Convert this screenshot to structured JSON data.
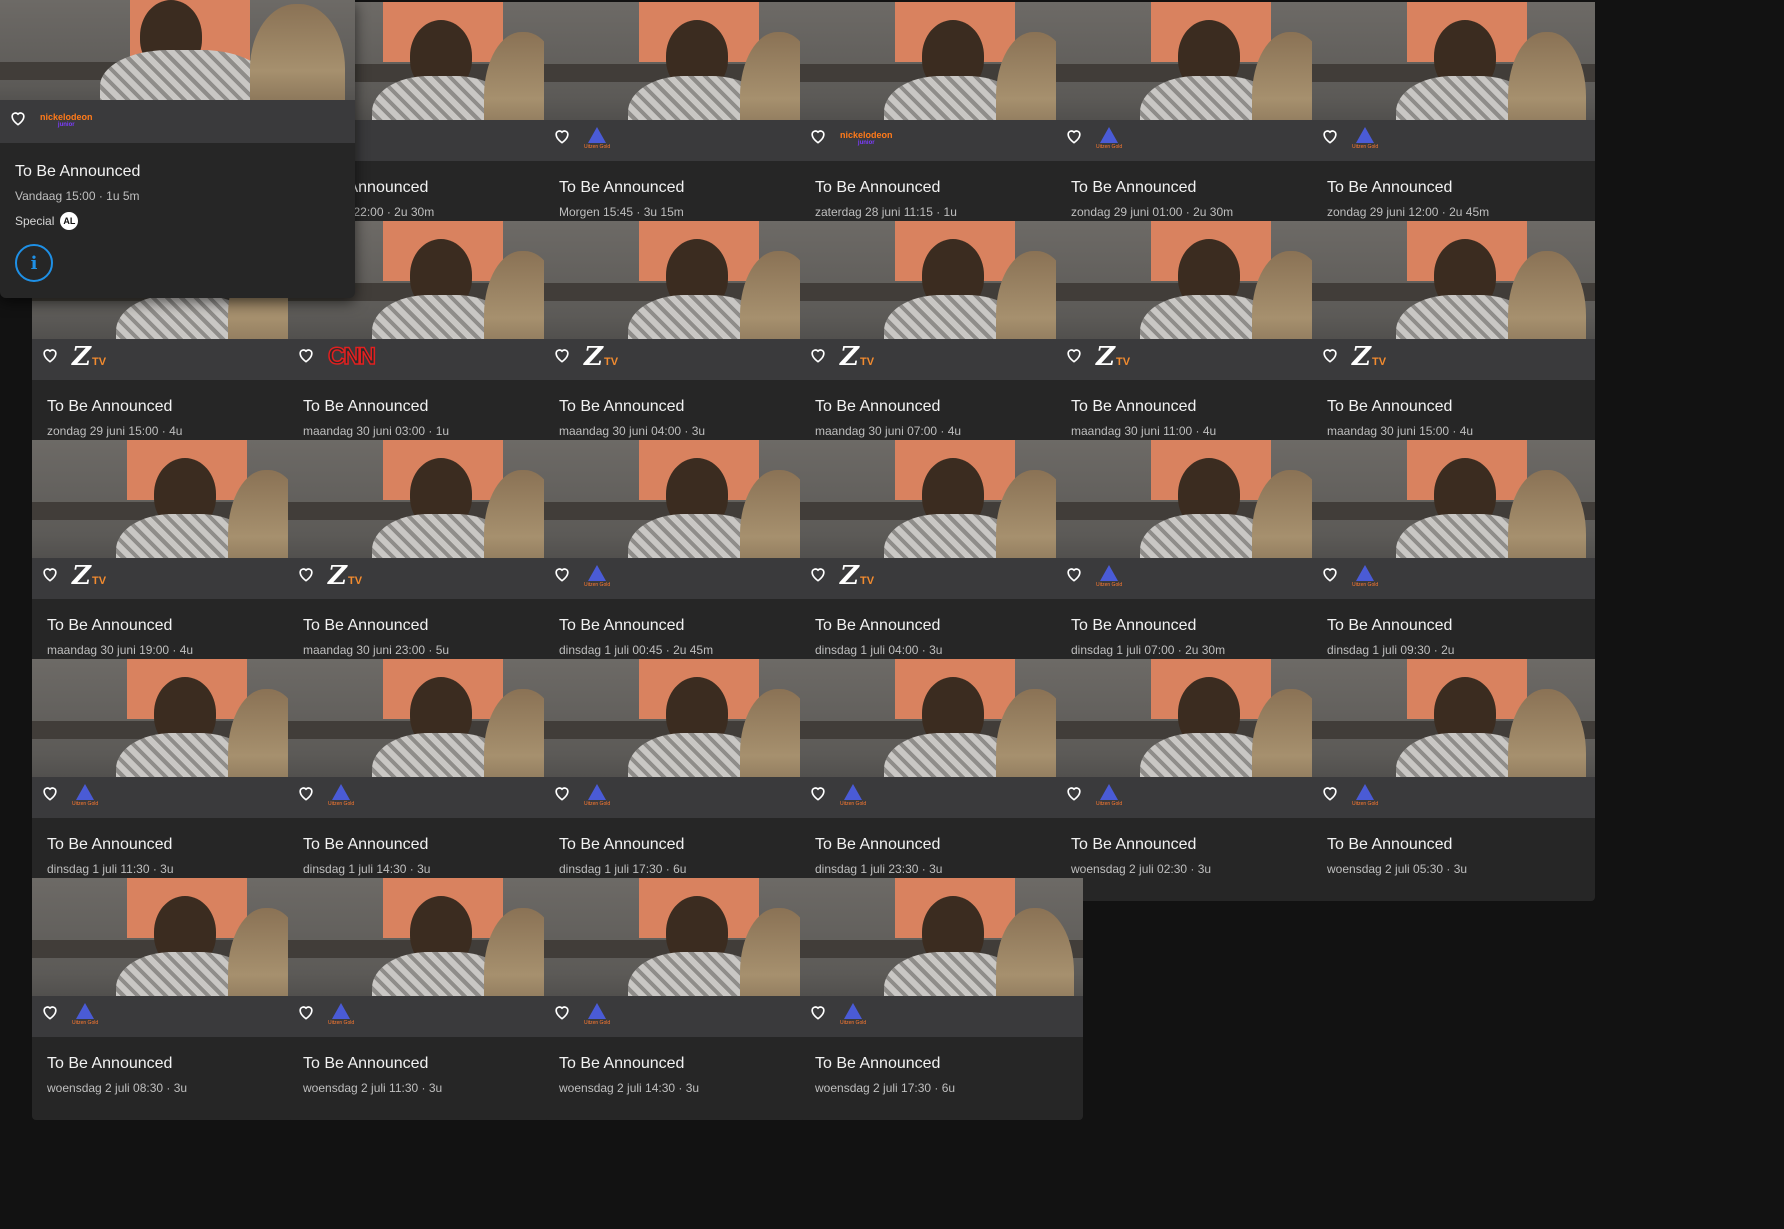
{
  "hover_card": {
    "title": "To Be Announced",
    "meta": "Vandaag 15:00 · 1u 5m",
    "genre": "Special",
    "age_rating": "AL",
    "channel_logo": "nickelodeon",
    "logo_text": "nickelodeon",
    "logo_sub": "junior",
    "info_icon": "info-icon",
    "favorite_icon": "heart-icon"
  },
  "cards": [
    {
      "title": "To Be Announced",
      "meta": "Vandaag 22:00 · 2u 30m",
      "channel": "uitzend"
    },
    {
      "title": "To Be Announced",
      "meta": "Morgen 15:45 · 3u 15m",
      "channel": "uitzend"
    },
    {
      "title": "To Be Announced",
      "meta": "zaterdag 28 juni 11:15 · 1u",
      "channel": "nick"
    },
    {
      "title": "To Be Announced",
      "meta": "zondag 29 juni 01:00 · 2u 30m",
      "channel": "uitzend"
    },
    {
      "title": "To Be Announced",
      "meta": "zondag 29 juni 12:00 · 2u 45m",
      "channel": "uitzend"
    },
    {
      "title": "To Be Announced",
      "meta": "zondag 29 juni 15:00 · 4u",
      "channel": "ztv"
    },
    {
      "title": "To Be Announced",
      "meta": "maandag 30 juni 03:00 · 1u",
      "channel": "cnn"
    },
    {
      "title": "To Be Announced",
      "meta": "maandag 30 juni 04:00 · 3u",
      "channel": "ztv"
    },
    {
      "title": "To Be Announced",
      "meta": "maandag 30 juni 07:00 · 4u",
      "channel": "ztv"
    },
    {
      "title": "To Be Announced",
      "meta": "maandag 30 juni 11:00 · 4u",
      "channel": "ztv"
    },
    {
      "title": "To Be Announced",
      "meta": "maandag 30 juni 15:00 · 4u",
      "channel": "ztv"
    },
    {
      "title": "To Be Announced",
      "meta": "maandag 30 juni 19:00 · 4u",
      "channel": "ztv"
    },
    {
      "title": "To Be Announced",
      "meta": "maandag 30 juni 23:00 · 5u",
      "channel": "ztv"
    },
    {
      "title": "To Be Announced",
      "meta": "dinsdag 1 juli 00:45 · 2u 45m",
      "channel": "uitzend"
    },
    {
      "title": "To Be Announced",
      "meta": "dinsdag 1 juli 04:00 · 3u",
      "channel": "ztv"
    },
    {
      "title": "To Be Announced",
      "meta": "dinsdag 1 juli 07:00 · 2u 30m",
      "channel": "uitzend"
    },
    {
      "title": "To Be Announced",
      "meta": "dinsdag 1 juli 09:30 · 2u",
      "channel": "uitzend"
    },
    {
      "title": "To Be Announced",
      "meta": "dinsdag 1 juli 11:30 · 3u",
      "channel": "uitzend"
    },
    {
      "title": "To Be Announced",
      "meta": "dinsdag 1 juli 14:30 · 3u",
      "channel": "uitzend"
    },
    {
      "title": "To Be Announced",
      "meta": "dinsdag 1 juli 17:30 · 6u",
      "channel": "uitzend"
    },
    {
      "title": "To Be Announced",
      "meta": "dinsdag 1 juli 23:30 · 3u",
      "channel": "uitzend"
    },
    {
      "title": "To Be Announced",
      "meta": "woensdag 2 juli 02:30 · 3u",
      "channel": "uitzend"
    },
    {
      "title": "To Be Announced",
      "meta": "woensdag 2 juli 05:30 · 3u",
      "channel": "uitzend"
    },
    {
      "title": "To Be Announced",
      "meta": "woensdag 2 juli 08:30 · 3u",
      "channel": "uitzend"
    },
    {
      "title": "To Be Announced",
      "meta": "woensdag 2 juli 11:30 · 3u",
      "channel": "uitzend"
    },
    {
      "title": "To Be Announced",
      "meta": "woensdag 2 juli 14:30 · 3u",
      "channel": "uitzend"
    },
    {
      "title": "To Be Announced",
      "meta": "woensdag 2 juli 17:30 · 6u",
      "channel": "uitzend"
    }
  ],
  "logos": {
    "ztv_letter": "Z",
    "ztv_suffix": "TV",
    "cnn_text": "CNN",
    "uitzend_text": "Uitzen Gold",
    "nick_text": "nickelodeon",
    "nick_sub": "junior"
  },
  "colors": {
    "background": "#121212",
    "card": "#262626",
    "accent": "#1e90e6"
  }
}
